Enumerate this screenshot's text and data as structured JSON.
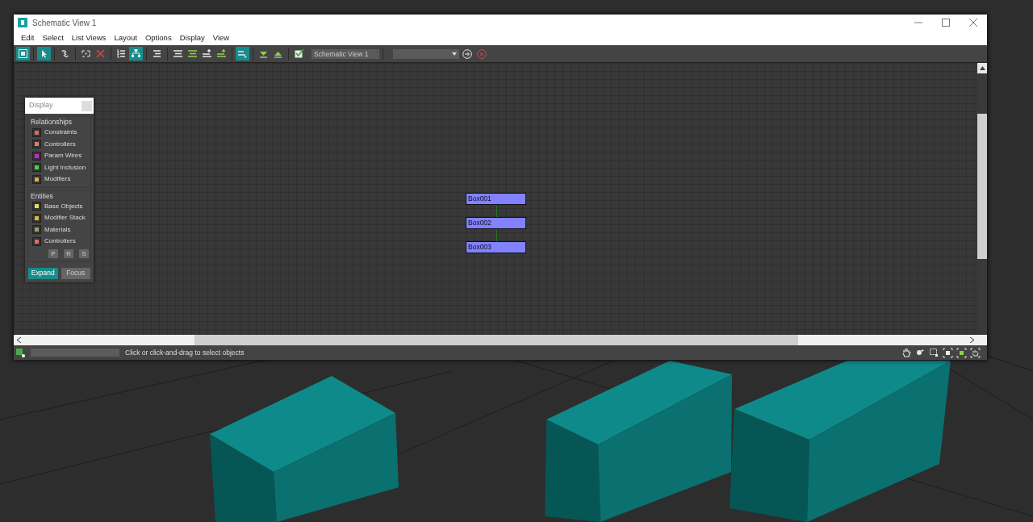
{
  "window": {
    "title": "Schematic View 1"
  },
  "menu": [
    "Edit",
    "Select",
    "List Views",
    "Layout",
    "Options",
    "Display",
    "View"
  ],
  "toolbar": {
    "buttons": [
      {
        "selected": true
      },
      {
        "selected": true
      },
      {
        "selected": false
      },
      {
        "selected": false
      },
      {
        "selected": false
      },
      {
        "selected": false
      },
      {
        "selected": true
      },
      {
        "selected": false
      },
      {
        "selected": false
      },
      {
        "selected": false
      },
      {
        "selected": false
      },
      {
        "selected": false
      },
      {
        "selected": true
      },
      {
        "selected": false
      },
      {
        "selected": false
      },
      {
        "selected": false
      }
    ],
    "view_name": "Schematic View 1"
  },
  "display_panel": {
    "title": "Display",
    "relationships": {
      "heading": "Relationships",
      "items": [
        {
          "label": "Constraints",
          "color": "#e06a6a"
        },
        {
          "label": "Controllers",
          "color": "#e07c6c"
        },
        {
          "label": "Param Wires",
          "color": "#d21ed2"
        },
        {
          "label": "Light Inclusion",
          "color": "#3ed83e"
        },
        {
          "label": "Modifiers",
          "color": "#d8b040"
        }
      ]
    },
    "entities": {
      "heading": "Entities",
      "items": [
        {
          "label": "Base Objects",
          "color": "#e8d860"
        },
        {
          "label": "Modifier Stack",
          "color": "#d8b838"
        },
        {
          "label": "Materials",
          "color": "#a89868"
        },
        {
          "label": "Controllers",
          "color": "#e06a6a"
        }
      ],
      "prs": [
        {
          "label": "P",
          "selected": false
        },
        {
          "label": "R",
          "selected": false
        },
        {
          "label": "S",
          "selected": false
        }
      ]
    },
    "buttons": [
      {
        "label": "Expand",
        "selected": true
      },
      {
        "label": "Focus",
        "selected": false
      }
    ]
  },
  "nodes": [
    {
      "label": "Box001"
    },
    {
      "label": "Box002"
    },
    {
      "label": "Box003"
    }
  ],
  "status_bar": {
    "prompt": "Click or click-and-drag to select objects"
  }
}
